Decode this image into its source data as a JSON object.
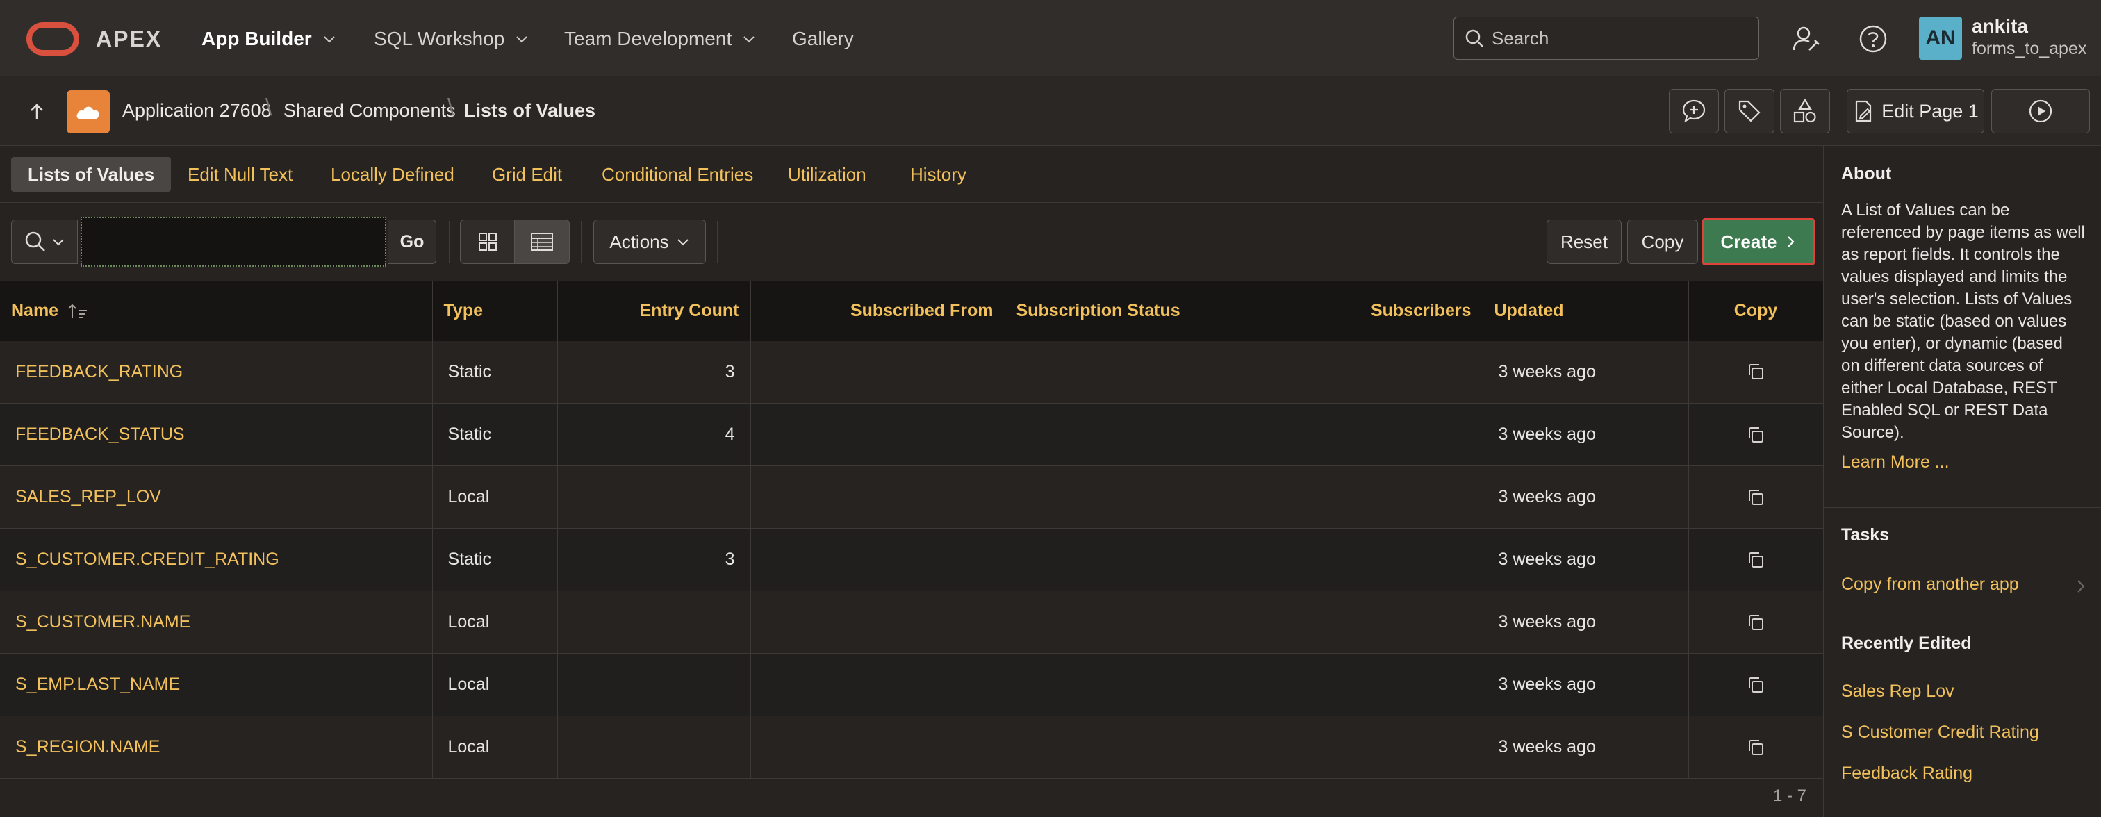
{
  "header": {
    "brand": "APEX",
    "nav": [
      {
        "label": "App Builder",
        "active": true
      },
      {
        "label": "SQL Workshop"
      },
      {
        "label": "Team Development"
      },
      {
        "label": "Gallery"
      }
    ],
    "search_placeholder": "Search",
    "user": {
      "initials": "AN",
      "name": "ankita",
      "workspace": "forms_to_apex"
    }
  },
  "breadcrumb": {
    "items": [
      "Application 27608",
      "Shared Components",
      "Lists of Values"
    ],
    "edit_page_label": "Edit Page 1"
  },
  "tabs": [
    "Lists of Values",
    "Edit Null Text",
    "Locally Defined",
    "Grid Edit",
    "Conditional Entries",
    "Utilization",
    "History"
  ],
  "toolbar": {
    "go_label": "Go",
    "actions_label": "Actions",
    "reset_label": "Reset",
    "copy_label": "Copy",
    "create_label": "Create"
  },
  "table": {
    "columns": [
      "Name",
      "Type",
      "Entry Count",
      "Subscribed From",
      "Subscription Status",
      "Subscribers",
      "Updated",
      "Copy"
    ],
    "rows": [
      {
        "name": "FEEDBACK_RATING",
        "type": "Static",
        "entry_count": "3",
        "subscribed_from": "",
        "subscription_status": "",
        "subscribers": "",
        "updated": "3 weeks ago"
      },
      {
        "name": "FEEDBACK_STATUS",
        "type": "Static",
        "entry_count": "4",
        "subscribed_from": "",
        "subscription_status": "",
        "subscribers": "",
        "updated": "3 weeks ago"
      },
      {
        "name": "SALES_REP_LOV",
        "type": "Local",
        "entry_count": "",
        "subscribed_from": "",
        "subscription_status": "",
        "subscribers": "",
        "updated": "3 weeks ago"
      },
      {
        "name": "S_CUSTOMER.CREDIT_RATING",
        "type": "Static",
        "entry_count": "3",
        "subscribed_from": "",
        "subscription_status": "",
        "subscribers": "",
        "updated": "3 weeks ago"
      },
      {
        "name": "S_CUSTOMER.NAME",
        "type": "Local",
        "entry_count": "",
        "subscribed_from": "",
        "subscription_status": "",
        "subscribers": "",
        "updated": "3 weeks ago"
      },
      {
        "name": "S_EMP.LAST_NAME",
        "type": "Local",
        "entry_count": "",
        "subscribed_from": "",
        "subscription_status": "",
        "subscribers": "",
        "updated": "3 weeks ago"
      },
      {
        "name": "S_REGION.NAME",
        "type": "Local",
        "entry_count": "",
        "subscribed_from": "",
        "subscription_status": "",
        "subscribers": "",
        "updated": "3 weeks ago"
      }
    ],
    "pagination": "1 - 7"
  },
  "sidebar": {
    "about_heading": "About",
    "about_text": "A List of Values can be referenced by page items as well as report fields. It controls the values displayed and limits the user's selection. Lists of Values can be static (based on values you enter), or dynamic (based on different data sources of either Local Database, REST Enabled SQL or REST Data Source).",
    "learn_more": "Learn More ...",
    "tasks_heading": "Tasks",
    "tasks": [
      "Copy from another app"
    ],
    "recent_heading": "Recently Edited",
    "recent": [
      "Sales Rep Lov",
      "S Customer Credit Rating",
      "Feedback Rating"
    ]
  },
  "colors": {
    "accent_link": "#f3c15c",
    "create_button": "#3d7a4f",
    "logo": "#d9503f",
    "app_icon": "#e8843a",
    "avatar": "#5ab0c8"
  }
}
